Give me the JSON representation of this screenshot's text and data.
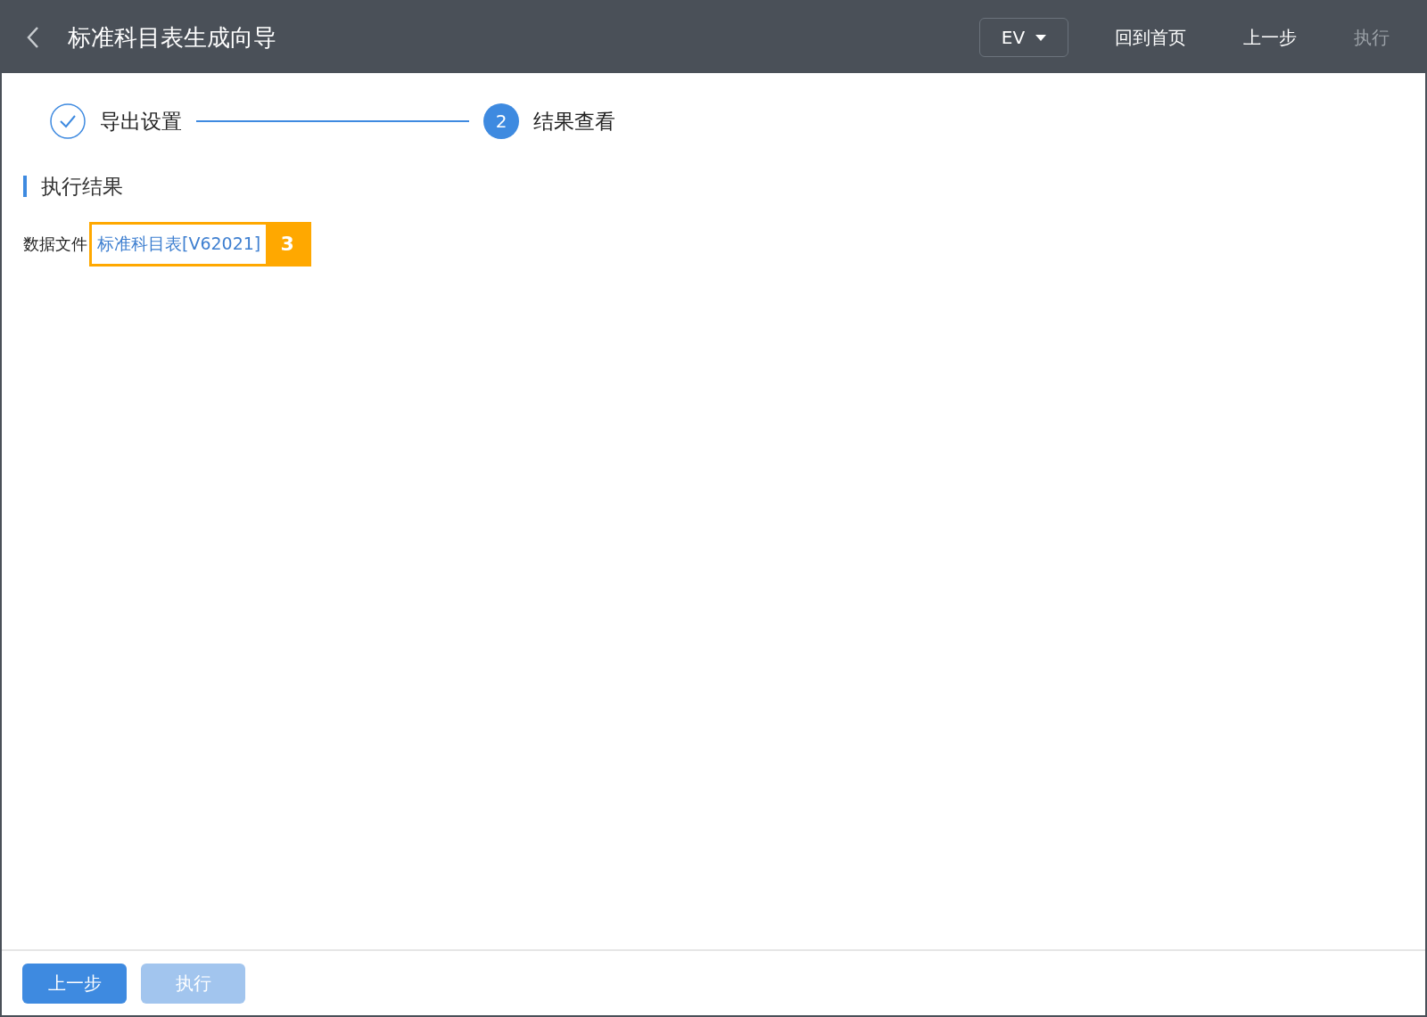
{
  "header": {
    "title": "标准科目表生成向导",
    "dropdown": "EV",
    "actions": [
      {
        "label": "回到首页",
        "disabled": false
      },
      {
        "label": "上一步",
        "disabled": false
      },
      {
        "label": "执行",
        "disabled": true
      }
    ]
  },
  "steps": [
    {
      "label": "导出设置",
      "done": true
    },
    {
      "marker": "2",
      "label": "结果查看",
      "done": false
    }
  ],
  "section": {
    "title": "执行结果",
    "field_label": "数据文件",
    "link": "标准科目表[V62021]",
    "callout": "3"
  },
  "footer": {
    "buttons": [
      {
        "label": "上一步",
        "disabled": false
      },
      {
        "label": "执行",
        "disabled": true
      }
    ]
  }
}
